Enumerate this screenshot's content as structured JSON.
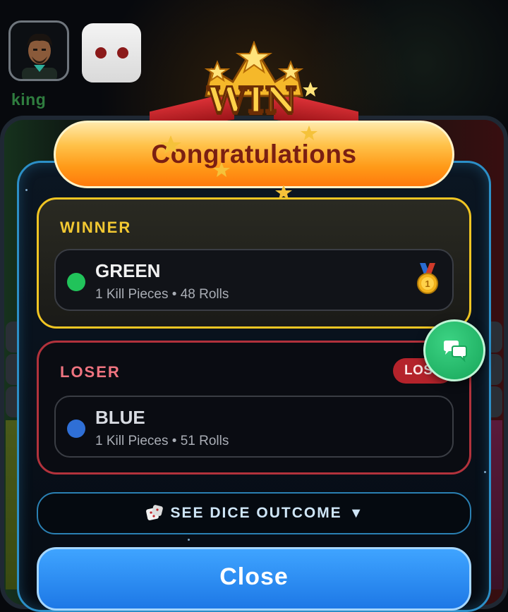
{
  "player": {
    "name": "king"
  },
  "overlay": {
    "badge_text": "WIN",
    "congrats": "Congratulations"
  },
  "winner": {
    "title": "WINNER",
    "color_name": "GREEN",
    "color": "#21c35a",
    "stats": "1 Kill Pieces • 48 Rolls",
    "medal_icon": "gold-medal-icon"
  },
  "loser": {
    "title": "LOSER",
    "badge": "LOST",
    "color_name": "BLUE",
    "color": "#2f6fd6",
    "stats": "1 Kill Pieces • 51 Rolls"
  },
  "dice_outcome": {
    "label": "SEE DICE OUTCOME",
    "arrow": "▼"
  },
  "close_button": {
    "label": "Close"
  },
  "colors": {
    "winner_border": "#f0c523",
    "loser_border": "#b2323c",
    "modal_border": "#2c8fc7",
    "chat_button": "#17a65a",
    "close_button": "#1d78e6"
  }
}
